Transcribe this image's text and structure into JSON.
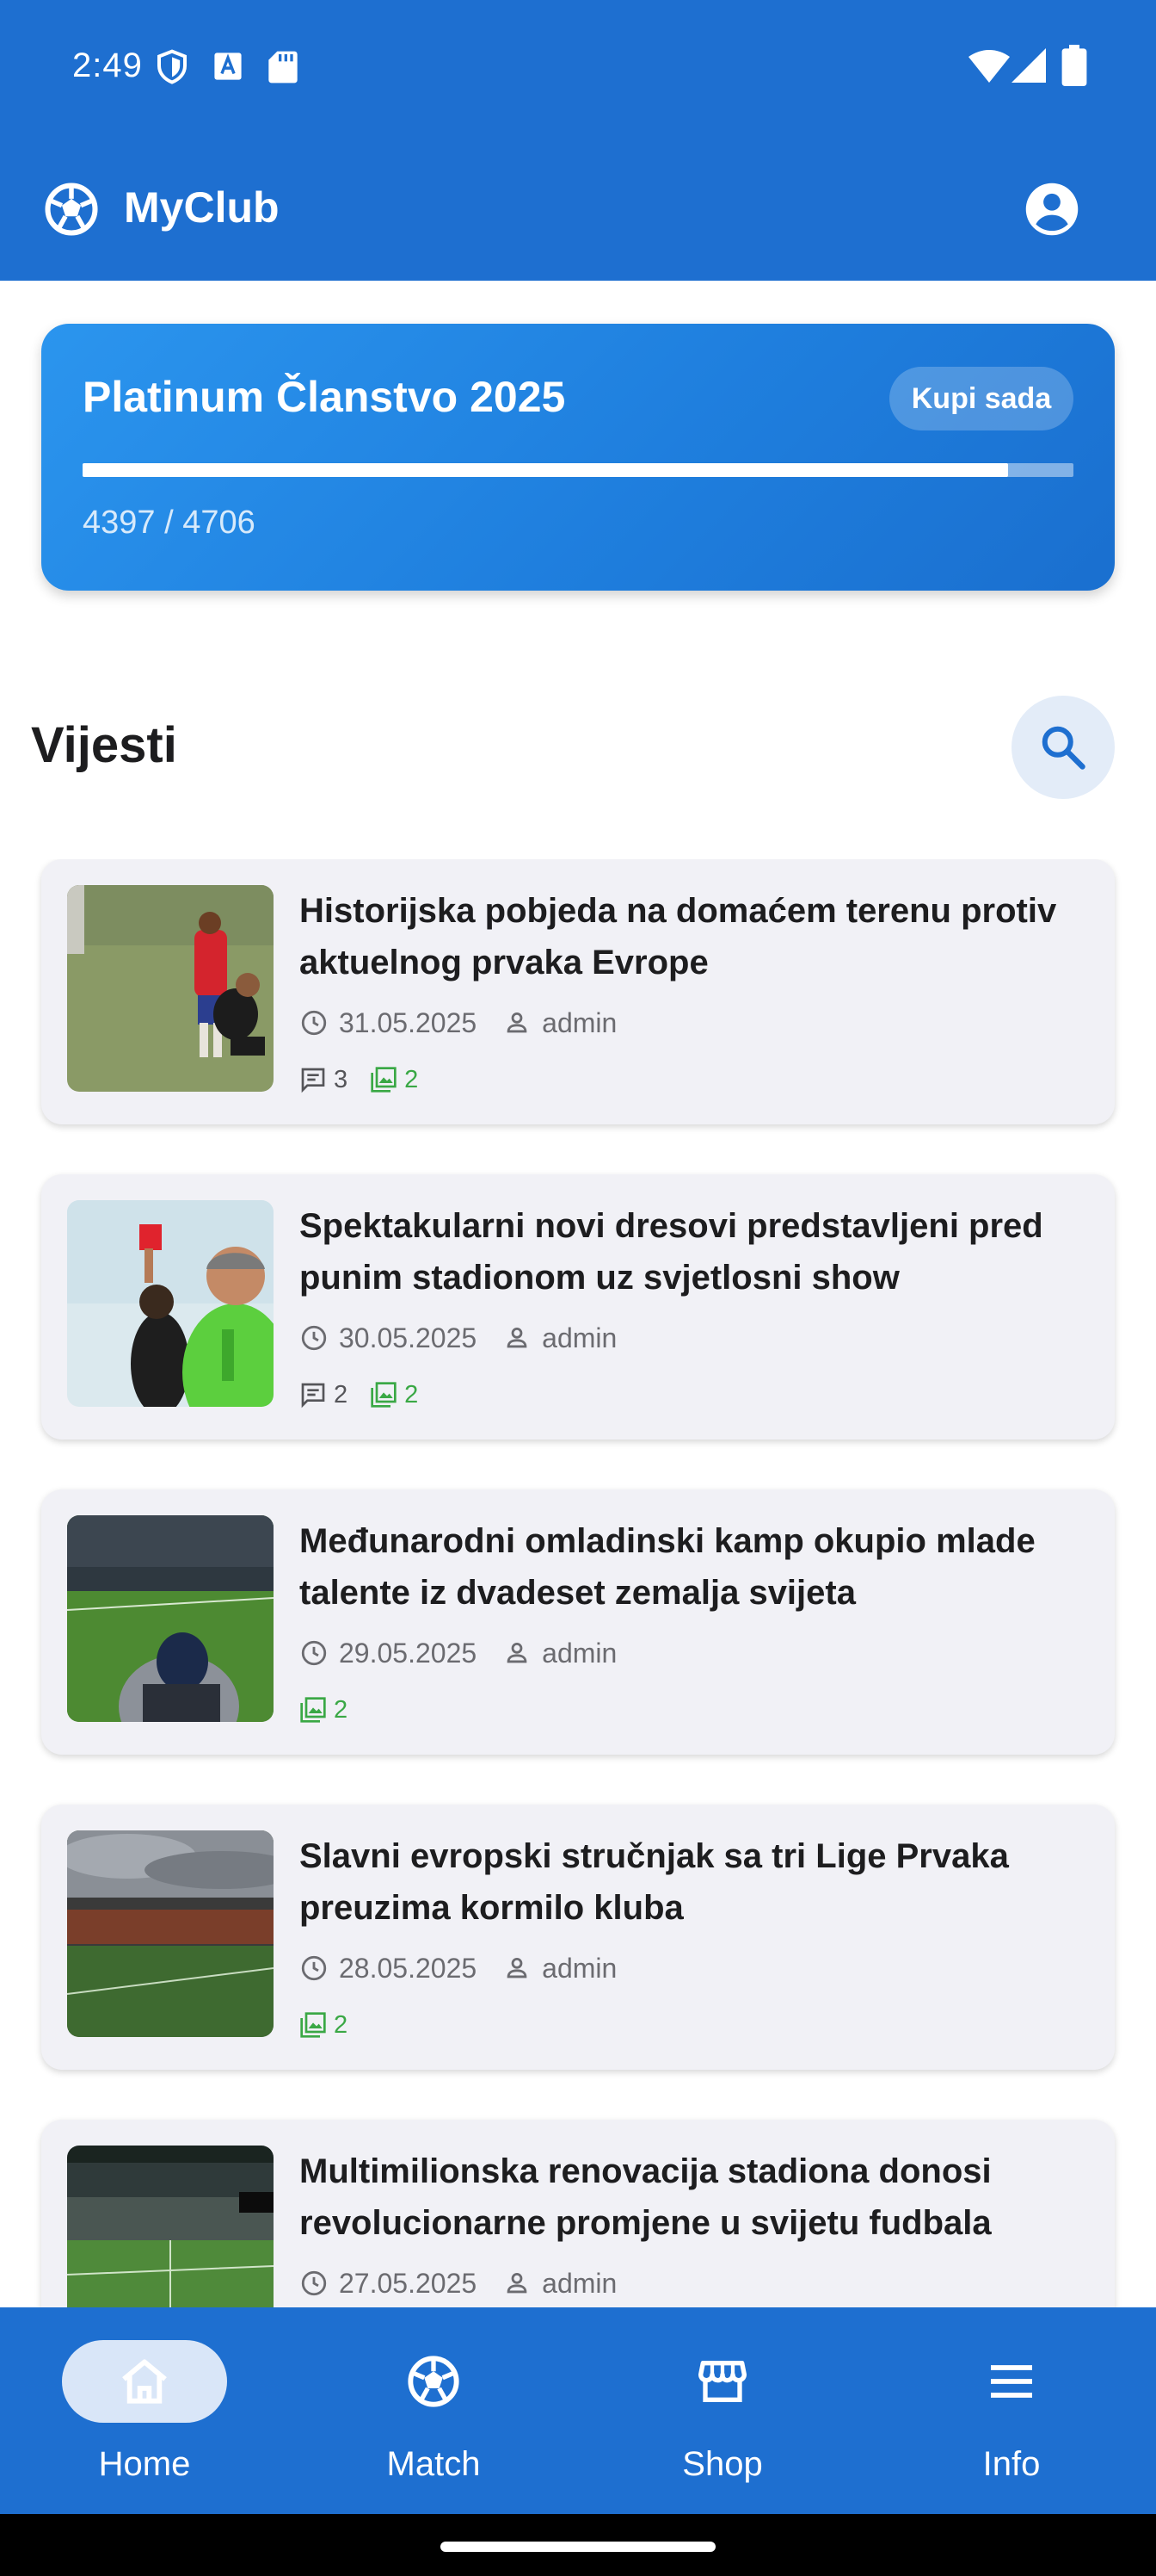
{
  "status_bar": {
    "time": "2:49",
    "icons": [
      "shield-icon",
      "a-box-icon",
      "sd-card-icon",
      "wifi-icon",
      "signal-icon",
      "battery-icon"
    ]
  },
  "app_bar": {
    "title": "MyClub",
    "logo_icon": "soccer-ball-icon",
    "profile_icon": "account-circle-icon"
  },
  "membership": {
    "title": "Platinum Članstvo 2025",
    "buy_label": "Kupi sada",
    "current": 4397,
    "total": 4706,
    "progress_text": "4397 / 4706",
    "progress_fraction": 0.9343
  },
  "news": {
    "section_title": "Vijesti",
    "search_icon": "search-icon",
    "items": [
      {
        "title": "Historijska pobjeda na domaćem terenu protiv aktuelnog prvaka Evrope",
        "date": "31.05.2025",
        "author": "admin",
        "comments": "3",
        "images": "2",
        "thumbnail": "youth-player-and-referee-photo"
      },
      {
        "title": "Spektakularni novi dresovi predstavljeni pred punim stadionom uz svjetlosni show",
        "date": "30.05.2025",
        "author": "admin",
        "comments": "2",
        "images": "2",
        "thumbnail": "referee-red-card-photo"
      },
      {
        "title": "Međunarodni omladinski kamp okupio mlade talente iz dvadeset zemalja svijeta",
        "date": "29.05.2025",
        "author": "admin",
        "comments": null,
        "images": "2",
        "thumbnail": "fan-in-stadium-photo"
      },
      {
        "title": "Slavni evropski stručnjak sa tri Lige Prvaka preuzima kormilo kluba",
        "date": "28.05.2025",
        "author": "admin",
        "comments": null,
        "images": "2",
        "thumbnail": "stadium-cloudy-sky-photo"
      },
      {
        "title": "Multimilionska renovacija stadiona donosi revolucionarne promjene u svijetu fudbala",
        "date": "27.05.2025",
        "author": "admin",
        "comments": null,
        "images": null,
        "thumbnail": "stadium-night-scoreboard-photo"
      }
    ]
  },
  "bottom_nav": {
    "items": [
      {
        "label": "Home",
        "icon": "home-icon",
        "active": true
      },
      {
        "label": "Match",
        "icon": "soccer-ball-icon",
        "active": false
      },
      {
        "label": "Shop",
        "icon": "storefront-icon",
        "active": false
      },
      {
        "label": "Info",
        "icon": "menu-icon",
        "active": false
      }
    ]
  },
  "colors": {
    "primary": "#1e6fd0",
    "card_gradient_start": "#2b95ee",
    "card_gradient_end": "#1a6fcf",
    "news_card_bg": "#f1f1f6",
    "gallery_green": "#3aa845",
    "active_nav_pill": "#d9e6f8"
  }
}
